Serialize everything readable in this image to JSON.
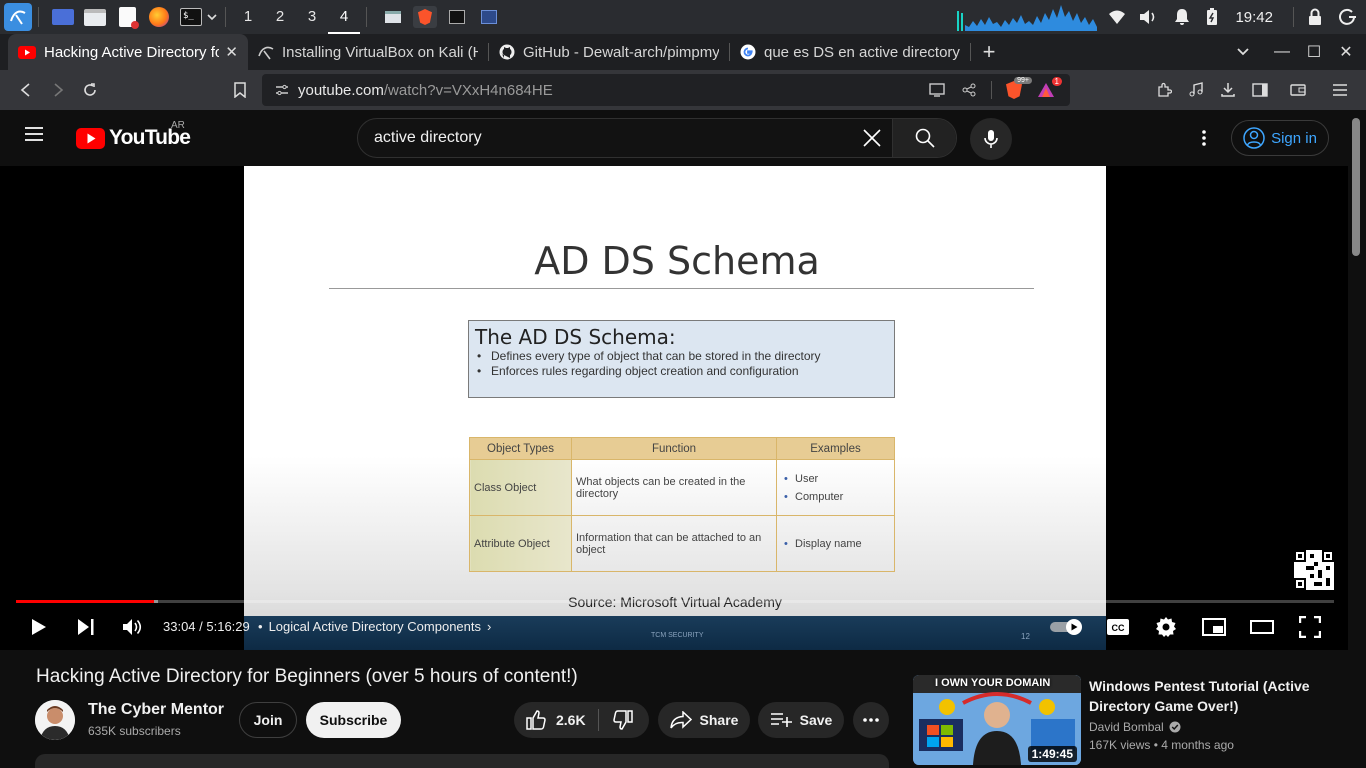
{
  "taskbar": {
    "workspaces": [
      "1",
      "2",
      "3",
      "4"
    ],
    "active_workspace": "4",
    "clock": "19:42"
  },
  "tabs": [
    {
      "label": "Hacking Active Directory fo",
      "icon": "youtube-icon",
      "active": true
    },
    {
      "label": "Installing VirtualBox on Kali (H",
      "icon": "kali-icon"
    },
    {
      "label": "GitHub - Dewalt-arch/pimpmy",
      "icon": "github-icon"
    },
    {
      "label": "que es DS en active directory ?",
      "icon": "google-icon"
    }
  ],
  "addressbar": {
    "url_host": "youtube.com",
    "url_path": "/watch?v=VXxH4n684HE",
    "brave_badge": "99+",
    "alert_badge": "1"
  },
  "youtube": {
    "logo_text": "YouTube",
    "country_code": "AR",
    "search_value": "active directory",
    "signin_label": "Sign in"
  },
  "slide": {
    "title": "AD DS Schema",
    "box_heading": "The AD DS Schema:",
    "box_bullets": [
      "Defines every type of object that can be stored in the directory",
      "Enforces rules regarding object creation and configuration"
    ],
    "table_headers": [
      "Object Types",
      "Function",
      "Examples"
    ],
    "table_rows": [
      {
        "type": "Class Object",
        "function": "What objects can be created in the directory",
        "examples": [
          "User",
          "Computer"
        ]
      },
      {
        "type": "Attribute Object",
        "function": "Information that can be attached to an object",
        "examples": [
          "Display name"
        ]
      }
    ],
    "source": "Source: Microsoft Virtual Academy",
    "footer_text": "TCM SECURITY",
    "page_number": "12"
  },
  "player": {
    "time": "33:04 / 5:16:29",
    "chapter": "Logical Active Directory Components",
    "played_fraction": 0.1046,
    "buffered_fraction": 0.003
  },
  "video": {
    "title": "Hacking Active Directory for Beginners (over 5 hours of content!)",
    "channel": "The Cyber Mentor",
    "subscribers": "635K subscribers",
    "join_label": "Join",
    "subscribe_label": "Subscribe",
    "likes": "2.6K",
    "share_label": "Share",
    "save_label": "Save"
  },
  "recommendation": {
    "thumb_text": "I OWN YOUR DOMAIN",
    "duration": "1:49:45",
    "title": "Windows Pentest Tutorial (Active Directory Game Over!)",
    "channel": "David Bombal",
    "meta": "167K views • 4 months ago"
  },
  "colors": {
    "youtube_red": "#ff0000",
    "accent_blue": "#3ea6ff",
    "table_header": "#e7cc94",
    "schema_box": "#dce6f1"
  }
}
